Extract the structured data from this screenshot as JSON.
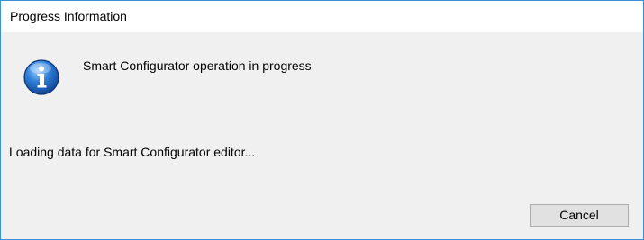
{
  "window": {
    "title": "Progress Information"
  },
  "dialog": {
    "icon": "info-icon",
    "message": "Smart Configurator operation in progress",
    "detail": "Loading data for Smart Configurator editor...",
    "cancel_label": "Cancel"
  },
  "colors": {
    "window_border": "#3c8fd6",
    "titlebar_bg": "#ffffff",
    "dialog_bg": "#f0f0f0",
    "button_bg": "#e1e1e1",
    "button_border": "#adadad"
  }
}
